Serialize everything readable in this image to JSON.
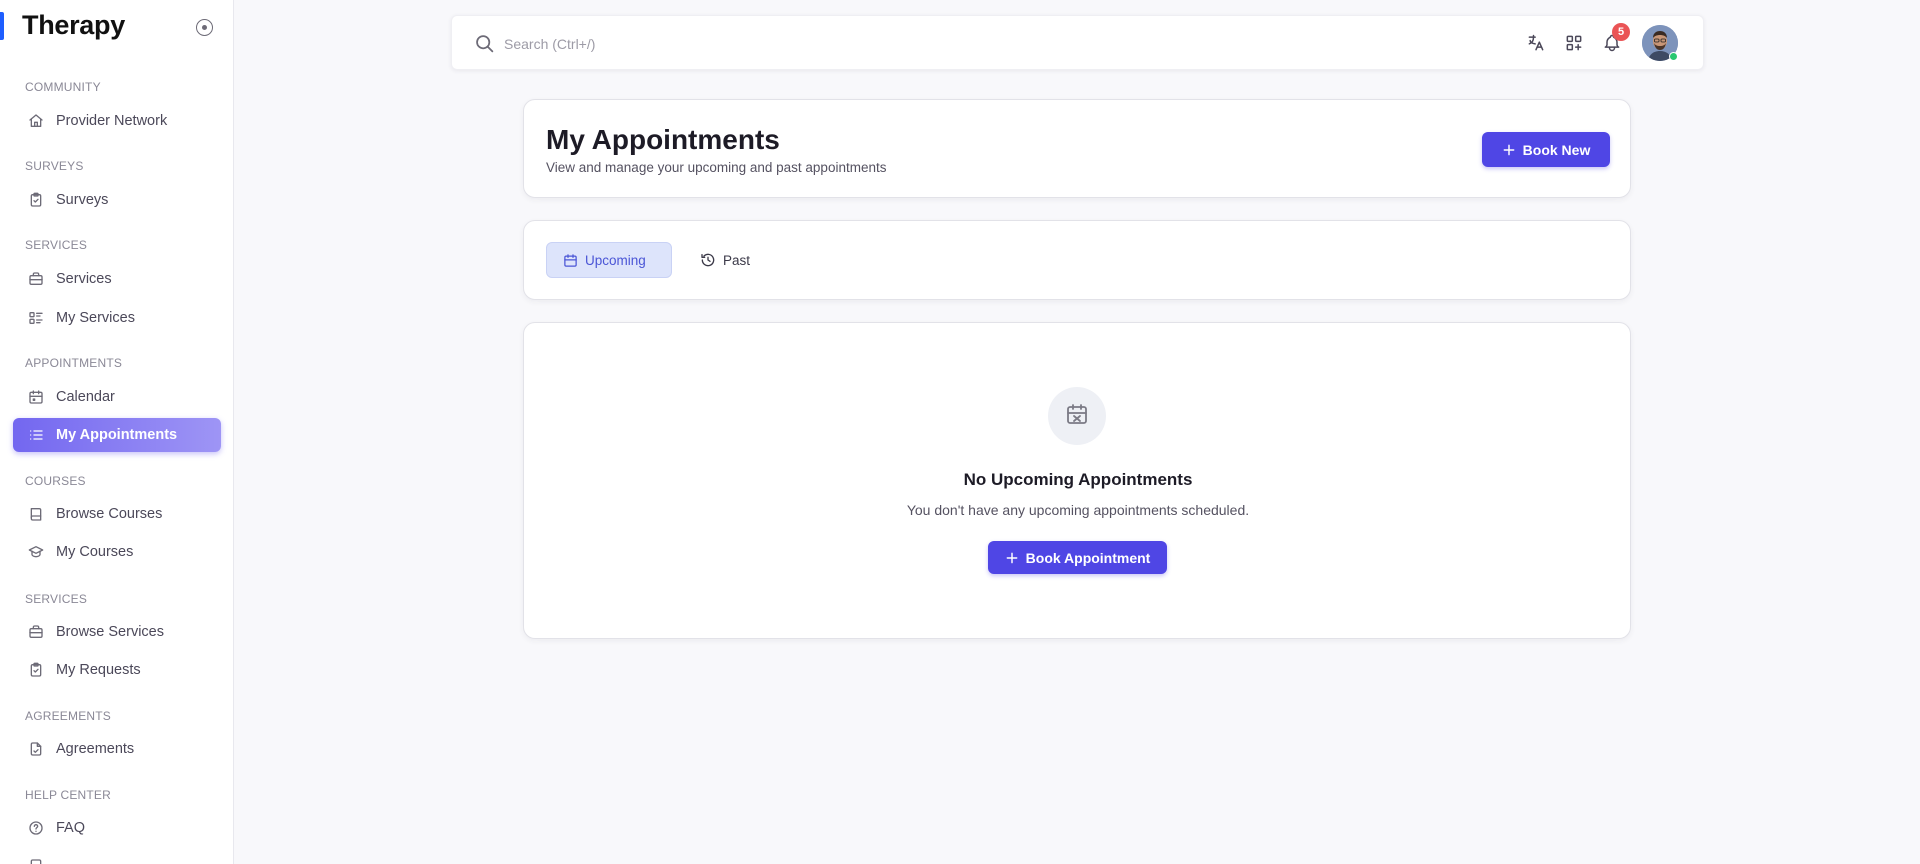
{
  "app": {
    "title": "Therapy"
  },
  "sidebar": {
    "sections": {
      "community": "COMMUNITY",
      "surveys": "SURVEYS",
      "services": "SERVICES",
      "appointments": "APPOINTMENTS",
      "courses": "COURSES",
      "services2": "SERVICES",
      "agreements": "AGREEMENTS",
      "help": "HELP CENTER"
    },
    "items": {
      "provider_network": "Provider Network",
      "surveys": "Surveys",
      "services": "Services",
      "my_services": "My Services",
      "calendar": "Calendar",
      "my_appointments": "My Appointments",
      "browse_courses": "Browse Courses",
      "my_courses": "My Courses",
      "browse_services": "Browse Services",
      "my_requests": "My Requests",
      "agreements": "Agreements",
      "faq": "FAQ"
    },
    "active_item": "my_appointments"
  },
  "topbar": {
    "search_placeholder": "Search (Ctrl+/)",
    "notification_count": "5",
    "icons": [
      "translate-icon",
      "apps-add-icon",
      "bell-icon"
    ]
  },
  "header": {
    "title": "My Appointments",
    "subtitle": "View and manage your upcoming and past appointments",
    "book_new_label": "Book New"
  },
  "tabs": [
    {
      "label": "Upcoming",
      "active": true
    },
    {
      "label": "Past",
      "active": false
    }
  ],
  "empty_state": {
    "title": "No Upcoming Appointments",
    "text": "You don't have any upcoming appointments scheduled.",
    "button_label": "Book Appointment"
  },
  "colors": {
    "primary": "#4f46e5",
    "active_nav": "#7367f0",
    "badge": "#ea5455",
    "online": "#28c76f"
  }
}
